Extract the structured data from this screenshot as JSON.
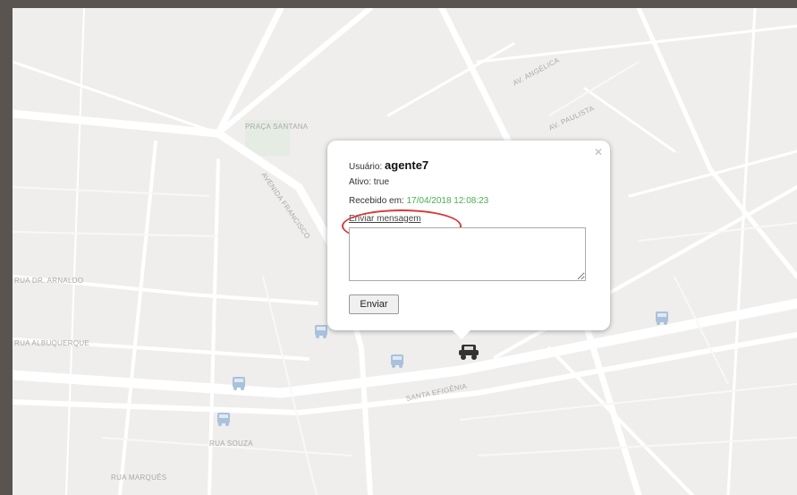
{
  "popup": {
    "user_label": "Usuário:",
    "user_value": "agente7",
    "active_label": "Ativo:",
    "active_value": "true",
    "last_update_label": "Recebido em:",
    "last_update_value": "17/04/2018 12:08:23",
    "link_label": "Enviar mensagem",
    "message_placeholder": "",
    "send_label": "Enviar"
  },
  "map": {
    "road_labels": [
      "PRAÇA SANTANA",
      "AV. ANGÉLICA",
      "AVENIDA FRANCISCO",
      "RUA DR. ARNALDO",
      "RUA ALBUQUERQUE",
      "AV. PAULISTA",
      "SANTA EFIGÊNIA",
      "RUA SOUZA",
      "RUA MARQUÊS"
    ]
  },
  "colors": {
    "map_background": "#efeeec",
    "road": "#ffffff",
    "frame": "#595450",
    "highlight": "#d93a3a",
    "timestamp": "#4caf50"
  }
}
